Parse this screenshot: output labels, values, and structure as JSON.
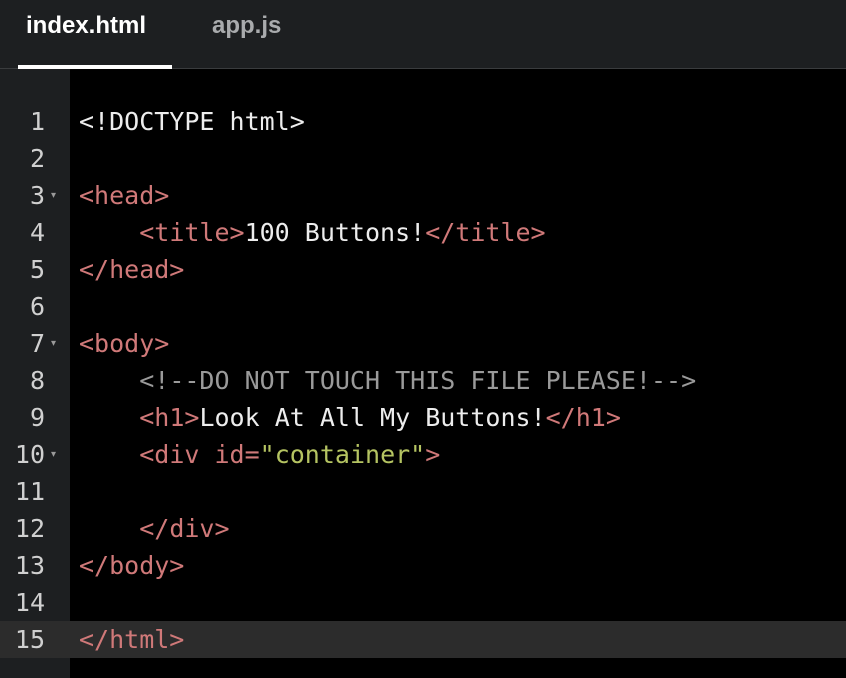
{
  "tabs": [
    {
      "label": "index.html",
      "active": true
    },
    {
      "label": "app.js",
      "active": false
    }
  ],
  "editor": {
    "current_line": 15,
    "lines": [
      {
        "n": "1",
        "fold": false,
        "tokens": [
          {
            "t": "plain",
            "v": "<!DOCTYPE html>"
          }
        ]
      },
      {
        "n": "2",
        "fold": false,
        "tokens": []
      },
      {
        "n": "3",
        "fold": true,
        "tokens": [
          {
            "t": "tag",
            "v": "<head>"
          }
        ]
      },
      {
        "n": "4",
        "fold": false,
        "tokens": [
          {
            "t": "plain",
            "v": "    "
          },
          {
            "t": "tag",
            "v": "<title>"
          },
          {
            "t": "txt",
            "v": "100 Buttons!"
          },
          {
            "t": "tag",
            "v": "</title>"
          }
        ]
      },
      {
        "n": "5",
        "fold": false,
        "tokens": [
          {
            "t": "tag",
            "v": "</head>"
          }
        ]
      },
      {
        "n": "6",
        "fold": false,
        "tokens": []
      },
      {
        "n": "7",
        "fold": true,
        "tokens": [
          {
            "t": "tag",
            "v": "<body>"
          }
        ]
      },
      {
        "n": "8",
        "fold": false,
        "tokens": [
          {
            "t": "plain",
            "v": "    "
          },
          {
            "t": "cmt",
            "v": "<!--DO NOT TOUCH THIS FILE PLEASE!-->"
          }
        ]
      },
      {
        "n": "9",
        "fold": false,
        "tokens": [
          {
            "t": "plain",
            "v": "    "
          },
          {
            "t": "tag",
            "v": "<h1>"
          },
          {
            "t": "txt",
            "v": "Look At All My Buttons!"
          },
          {
            "t": "tag",
            "v": "</h1>"
          }
        ]
      },
      {
        "n": "10",
        "fold": true,
        "tokens": [
          {
            "t": "plain",
            "v": "    "
          },
          {
            "t": "tag",
            "v": "<div "
          },
          {
            "t": "attr",
            "v": "id"
          },
          {
            "t": "eq",
            "v": "="
          },
          {
            "t": "str",
            "v": "\"container\""
          },
          {
            "t": "tag",
            "v": ">"
          }
        ]
      },
      {
        "n": "11",
        "fold": false,
        "tokens": []
      },
      {
        "n": "12",
        "fold": false,
        "tokens": [
          {
            "t": "plain",
            "v": "    "
          },
          {
            "t": "tag",
            "v": "</div>"
          }
        ]
      },
      {
        "n": "13",
        "fold": false,
        "tokens": [
          {
            "t": "tag",
            "v": "</body>"
          }
        ]
      },
      {
        "n": "14",
        "fold": false,
        "tokens": []
      },
      {
        "n": "15",
        "fold": false,
        "tokens": [
          {
            "t": "tag",
            "v": "</html>"
          }
        ]
      }
    ]
  },
  "icons": {
    "fold": "fold-arrow-icon"
  },
  "colors": {
    "background": "#000000",
    "gutter": "#1d1f21",
    "tag": "#d07979",
    "string": "#b5c462",
    "comment": "#9a9a9a",
    "text": "#ededed",
    "current_line": "#2c2c2c"
  }
}
